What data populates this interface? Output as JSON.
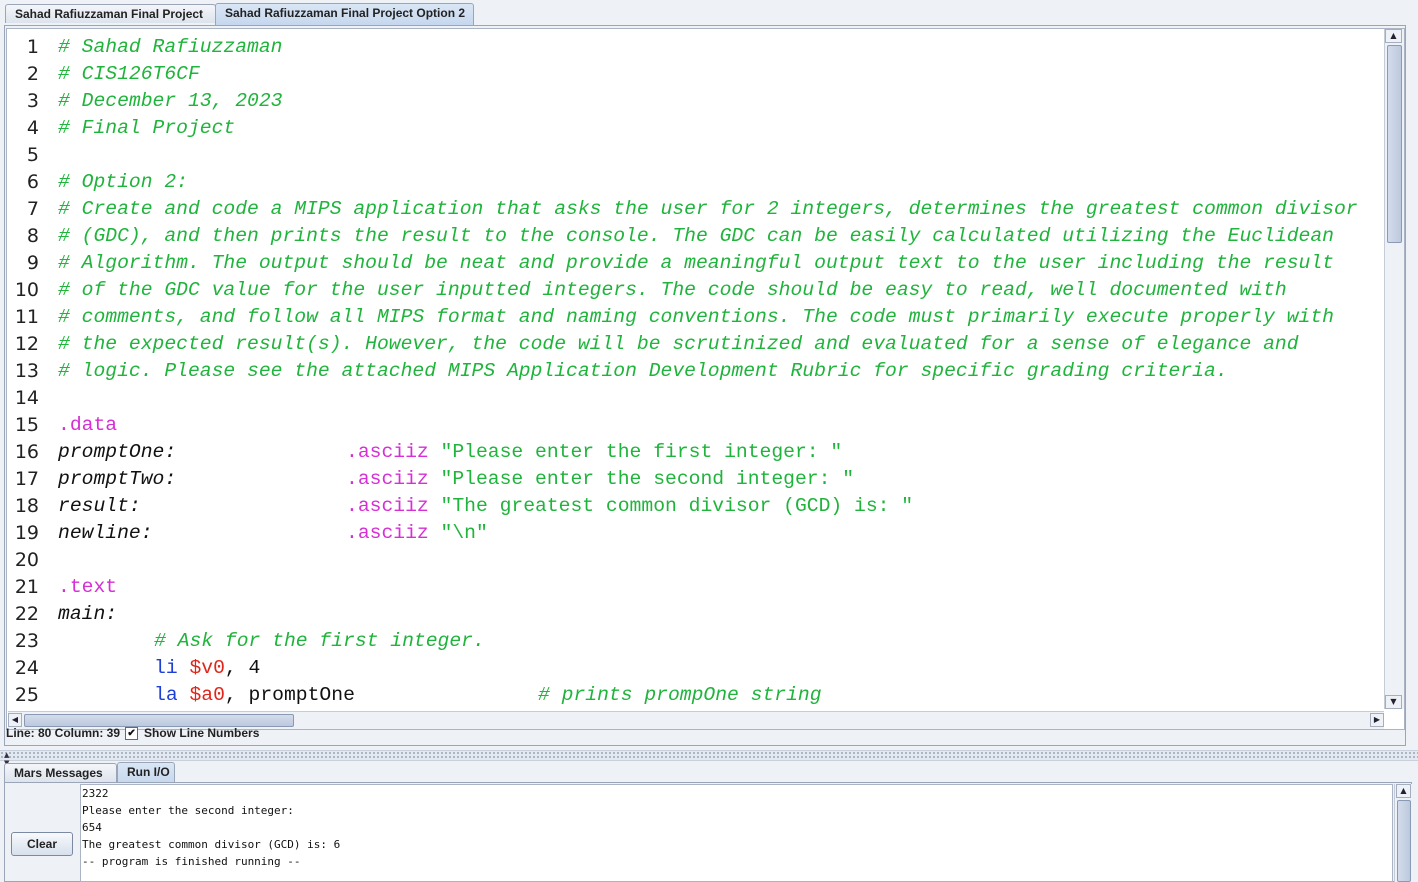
{
  "editor_tabs": [
    {
      "label": "Sahad Rafiuzzaman Final Project",
      "active": false
    },
    {
      "label": "Sahad Rafiuzzaman Final Project Option 2",
      "active": true
    }
  ],
  "line_numbers": [
    "1",
    "2",
    "3",
    "4",
    "5",
    "6",
    "7",
    "8",
    "9",
    "10",
    "11",
    "12",
    "13",
    "14",
    "15",
    "16",
    "17",
    "18",
    "19",
    "20",
    "21",
    "22",
    "23",
    "24",
    "25"
  ],
  "code": {
    "l1": "# Sahad Rafiuzzaman",
    "l2": "# CIS126T6CF",
    "l3": "# December 13, 2023",
    "l4": "# Final Project",
    "l6": "# Option 2:",
    "l7": "# Create and code a MIPS application that asks the user for 2 integers, determines the greatest common divisor",
    "l8": "# (GDC), and then prints the result to the console. The GDC can be easily calculated utilizing the Euclidean",
    "l9": "# Algorithm. The output should be neat and provide a meaningful output text to the user including the result",
    "l10": "# of the GDC value for the user inputted integers. The code should be easy to read, well documented with",
    "l11": "# comments, and follow all MIPS format and naming conventions. The code must primarily execute properly with",
    "l12": "# the expected result(s). However, the code will be scrutinized and evaluated for a sense of elegance and",
    "l13": "# logic. Please see the attached MIPS Application Development Rubric for specific grading criteria.",
    "l15_dir": ".data",
    "l16_label": "promptOne:",
    "l16_dir": ".asciiz",
    "l16_str": "\"Please enter the first integer: \"",
    "l17_label": "promptTwo:",
    "l17_dir": ".asciiz",
    "l17_str": "\"Please enter the second integer: \"",
    "l18_label": "result:",
    "l18_dir": ".asciiz",
    "l18_str": "\"The greatest common divisor (GCD) is: \"",
    "l19_label": "newline:",
    "l19_dir": ".asciiz",
    "l19_str": "\"\\n\"",
    "l21_dir": ".text",
    "l22_label": "main:",
    "l23_comment": "# Ask for the first integer.",
    "l24_op": "li",
    "l24_reg": "$v0",
    "l24_rest": ", 4",
    "l25_op": "la",
    "l25_reg": "$a0",
    "l25_rest": ", promptOne",
    "l25_comment": "# prints prompOne string"
  },
  "status": {
    "position": "Line: 80 Column: 39",
    "show_line_numbers_label": "Show Line Numbers",
    "show_line_numbers_checked": true
  },
  "bottom_tabs": [
    {
      "label": "Mars Messages",
      "active": false
    },
    {
      "label": "Run I/O",
      "active": true
    }
  ],
  "run_io": {
    "clear_label": "Clear",
    "lines": [
      "2322",
      "Please enter the second integer:",
      "654",
      "The greatest common divisor (GCD) is: 6",
      "-- program is finished running --"
    ]
  },
  "colors": {
    "comment": "#1fb43b",
    "directive": "#d62fd6",
    "instruction": "#1d3fd6",
    "register": "#e0261a"
  },
  "icons": {
    "scroll_up": "▲",
    "scroll_down": "▼",
    "scroll_left": "◀",
    "scroll_right": "▶",
    "check": "✔"
  }
}
